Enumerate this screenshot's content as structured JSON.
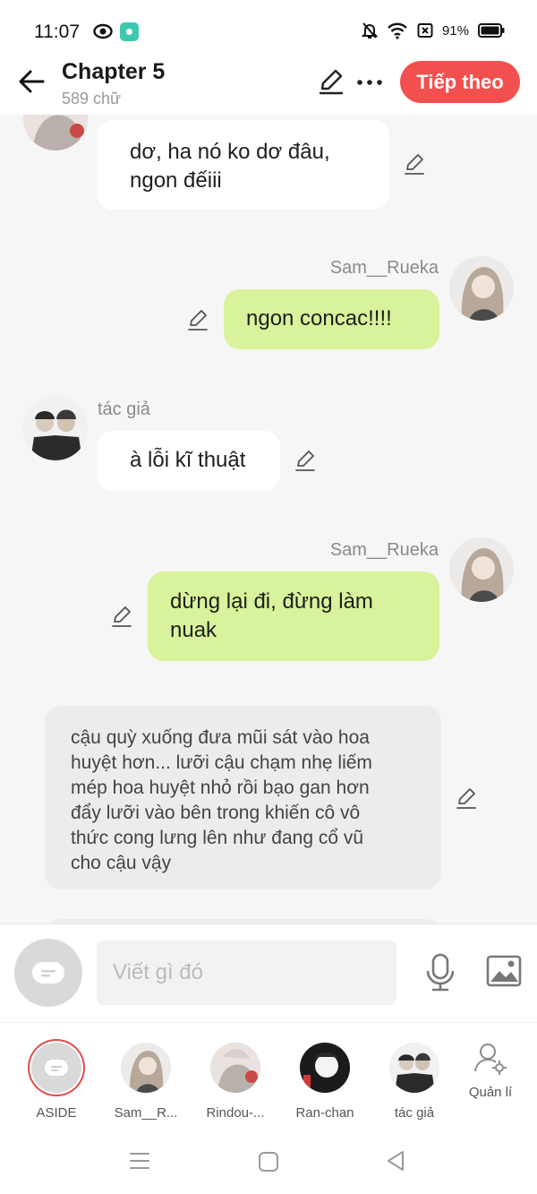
{
  "status_bar": {
    "time": "11:07",
    "battery": "91%"
  },
  "header": {
    "title": "Chapter 5",
    "subtitle": "589 chữ",
    "next_label": "Tiếp theo"
  },
  "messages": [
    {
      "text_lines": [
        "dơ, ha nó ko dơ đâu,",
        "ngon đếiii"
      ]
    },
    {
      "sender": "Sam__Rueka",
      "text": "ngon concac!!!!"
    },
    {
      "sender": "tác giả",
      "text": "à lỗi kĩ thuật"
    },
    {
      "sender": "Sam__Rueka",
      "text_lines": [
        "dừng lại đi, đừng làm",
        "nuak"
      ]
    },
    {
      "narration_lines": [
        "cậu quỳ xuống đưa mũi sát vào hoa",
        "huyệt hơn... lưỡi cậu chạm nhẹ liếm",
        "mép hoa huyệt nhỏ rồi bạo gan hơn",
        "đẩy lưỡi vào bên trong khiến cô vô",
        "thức cong lưng lên như đang cổ vũ",
        "cho cậu vậy"
      ]
    }
  ],
  "input": {
    "placeholder": "Viết gì đó"
  },
  "characters": [
    {
      "label": "ASIDE"
    },
    {
      "label": "Sam__R..."
    },
    {
      "label": "Rindou-..."
    },
    {
      "label": "Ran-chan"
    },
    {
      "label": "tác giả"
    },
    {
      "label": "Quản lí"
    }
  ],
  "colors": {
    "accent": "#f2504e",
    "bubble_green": "#d8f39b",
    "bubble_white": "#ffffff",
    "narration_bg": "#ececec"
  }
}
